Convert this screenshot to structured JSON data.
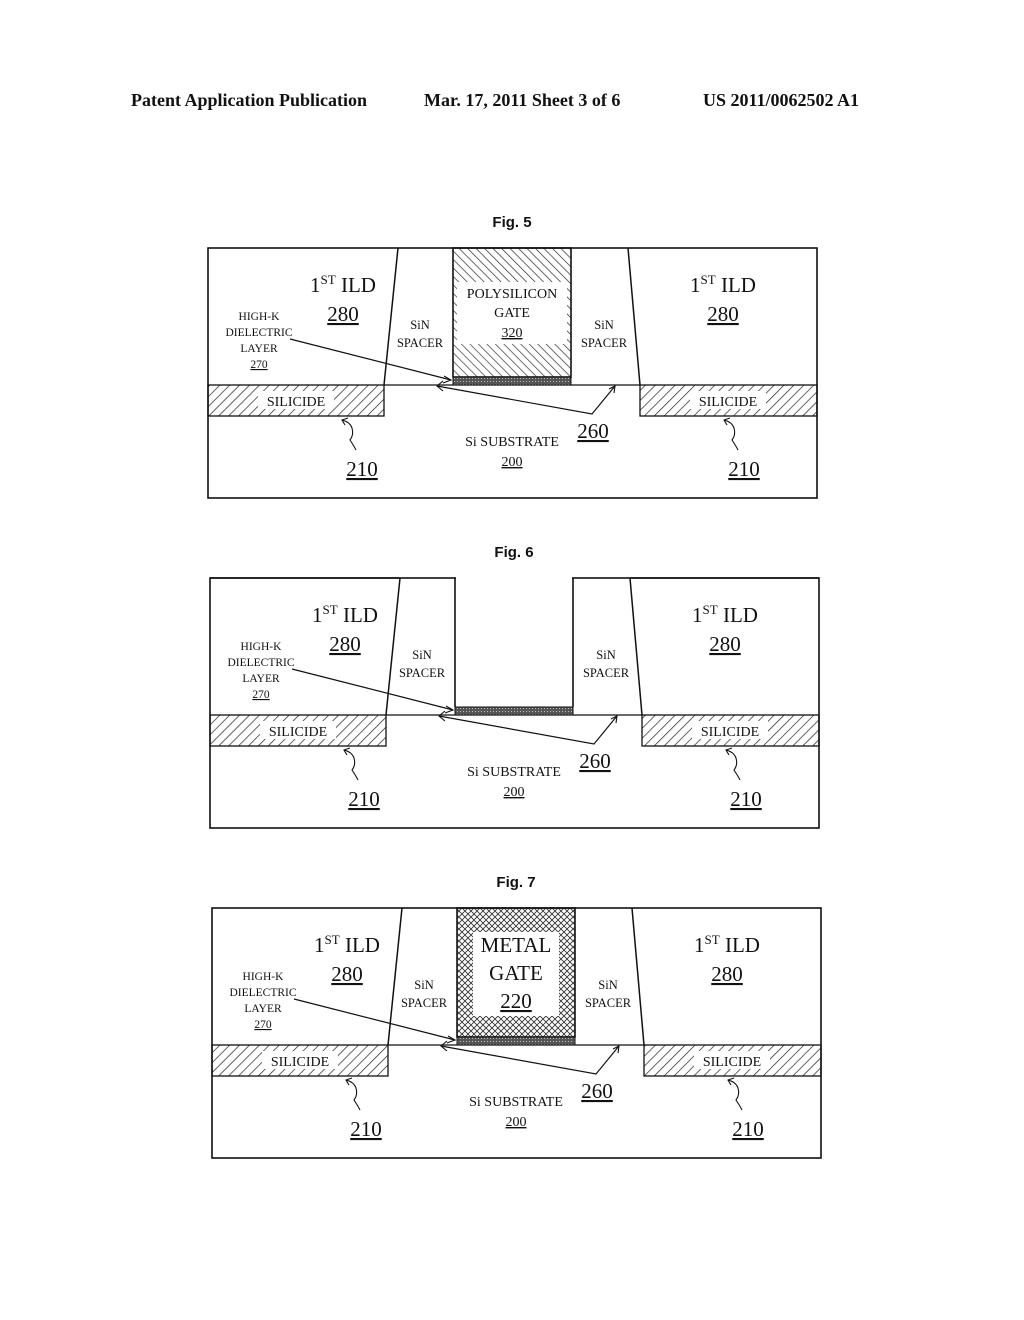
{
  "header": {
    "left": "Patent Application Publication",
    "center": "Mar. 17, 2011  Sheet 3 of 6",
    "right": "US 2011/0062502 A1"
  },
  "figures": [
    {
      "title": "Fig. 5",
      "ild_left": {
        "label": "1",
        "sup": "ST",
        "suffix": " ILD",
        "ref": "280"
      },
      "ild_right": {
        "label": "1",
        "sup": "ST",
        "suffix": " ILD",
        "ref": "280"
      },
      "high_k": {
        "lines": [
          "HIGH-K",
          "DIELECTRIC",
          "LAYER"
        ],
        "ref": "270"
      },
      "spacer_left": [
        "SiN",
        "SPACER"
      ],
      "spacer_right": [
        "SiN",
        "SPACER"
      ],
      "gate": {
        "type": "polysilicon",
        "lines": [
          "POLYSILICON",
          "GATE"
        ],
        "ref": "320"
      },
      "silicide_left": "SILICIDE",
      "silicide_right": "SILICIDE",
      "silicide_ref_left": "210",
      "silicide_ref_right": "210",
      "substrate": {
        "label": "Si SUBSTRATE",
        "ref": "200"
      },
      "channel_ref": "260"
    },
    {
      "title": "Fig. 6",
      "ild_left": {
        "label": "1",
        "sup": "ST",
        "suffix": " ILD",
        "ref": "280"
      },
      "ild_right": {
        "label": "1",
        "sup": "ST",
        "suffix": " ILD",
        "ref": "280"
      },
      "high_k": {
        "lines": [
          "HIGH-K",
          "DIELECTRIC",
          "LAYER"
        ],
        "ref": "270"
      },
      "spacer_left": [
        "SiN",
        "SPACER"
      ],
      "spacer_right": [
        "SiN",
        "SPACER"
      ],
      "gate": {
        "type": "empty",
        "lines": [],
        "ref": ""
      },
      "silicide_left": "SILICIDE",
      "silicide_right": "SILICIDE",
      "silicide_ref_left": "210",
      "silicide_ref_right": "210",
      "substrate": {
        "label": "Si SUBSTRATE",
        "ref": "200"
      },
      "channel_ref": "260"
    },
    {
      "title": "Fig. 7",
      "ild_left": {
        "label": "1",
        "sup": "ST",
        "suffix": " ILD",
        "ref": "280"
      },
      "ild_right": {
        "label": "1",
        "sup": "ST",
        "suffix": " ILD",
        "ref": "280"
      },
      "high_k": {
        "lines": [
          "HIGH-K",
          "DIELECTRIC",
          "LAYER"
        ],
        "ref": "270"
      },
      "spacer_left": [
        "SiN",
        "SPACER"
      ],
      "spacer_right": [
        "SiN",
        "SPACER"
      ],
      "gate": {
        "type": "metal",
        "lines": [
          "METAL",
          "GATE"
        ],
        "ref": "220"
      },
      "silicide_left": "SILICIDE",
      "silicide_right": "SILICIDE",
      "silicide_ref_left": "210",
      "silicide_ref_right": "210",
      "substrate": {
        "label": "Si SUBSTRATE",
        "ref": "200"
      },
      "channel_ref": "260"
    }
  ]
}
